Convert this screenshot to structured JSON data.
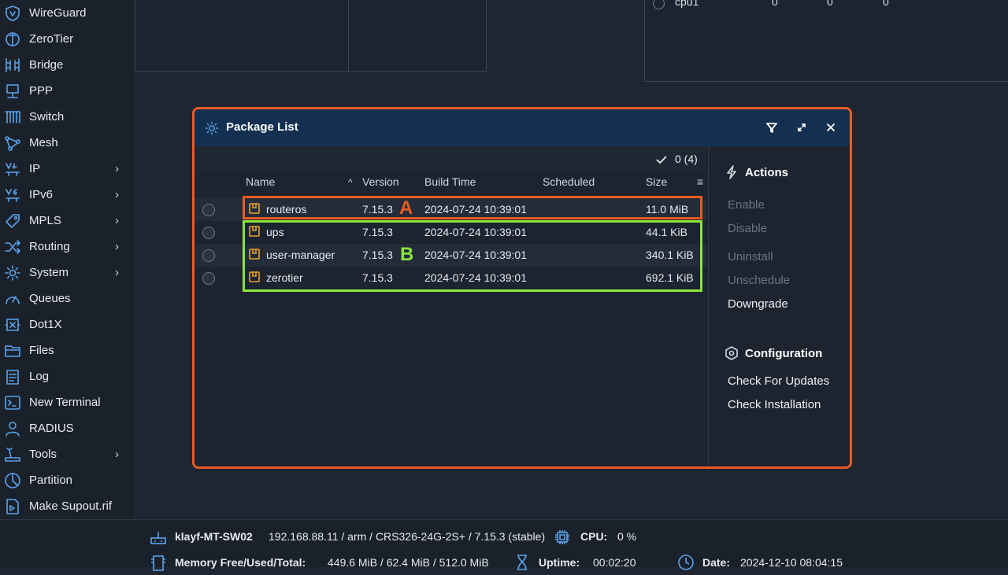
{
  "sidebar": {
    "items": [
      {
        "label": "WireGuard",
        "icon": "wireguard-icon",
        "submenu": false
      },
      {
        "label": "ZeroTier",
        "icon": "zerotier-icon",
        "submenu": false
      },
      {
        "label": "Bridge",
        "icon": "bridge-icon",
        "submenu": false
      },
      {
        "label": "PPP",
        "icon": "ppp-icon",
        "submenu": false
      },
      {
        "label": "Switch",
        "icon": "switch-icon",
        "submenu": false
      },
      {
        "label": "Mesh",
        "icon": "mesh-icon",
        "submenu": false
      },
      {
        "label": "IP",
        "icon": "ipv4-icon",
        "submenu": true
      },
      {
        "label": "IPv6",
        "icon": "ipv6-icon",
        "submenu": true
      },
      {
        "label": "MPLS",
        "icon": "mpls-icon",
        "submenu": true
      },
      {
        "label": "Routing",
        "icon": "routing-icon",
        "submenu": true
      },
      {
        "label": "System",
        "icon": "system-gear-icon",
        "submenu": true
      },
      {
        "label": "Queues",
        "icon": "queues-gauge-icon",
        "submenu": false
      },
      {
        "label": "Dot1X",
        "icon": "dot1x-icon",
        "submenu": false
      },
      {
        "label": "Files",
        "icon": "folder-icon",
        "submenu": false
      },
      {
        "label": "Log",
        "icon": "log-icon",
        "submenu": false
      },
      {
        "label": "New Terminal",
        "icon": "terminal-icon",
        "submenu": false
      },
      {
        "label": "RADIUS",
        "icon": "radius-users-icon",
        "submenu": false
      },
      {
        "label": "Tools",
        "icon": "tools-icon",
        "submenu": true
      },
      {
        "label": "Partition",
        "icon": "partition-icon",
        "submenu": false
      },
      {
        "label": "Make Supout.rif",
        "icon": "supout-file-icon",
        "submenu": false
      }
    ],
    "chevron": "›"
  },
  "background": {
    "cpu_row": {
      "label": "cpu1",
      "v1": "0",
      "v2": "0",
      "v3": "0"
    }
  },
  "dialog": {
    "title": "Package List",
    "count": "0 (4)",
    "columns": {
      "name": "Name",
      "sort_arrow": "^",
      "version": "Version",
      "build_time": "Build Time",
      "scheduled": "Scheduled",
      "size": "Size",
      "menu": "≡"
    },
    "rows": [
      {
        "name": "routeros",
        "version": "7.15.3",
        "build_time": "2024-07-24 10:39:01",
        "scheduled": "",
        "size": "11.0 MiB"
      },
      {
        "name": "ups",
        "version": "7.15.3",
        "build_time": "2024-07-24 10:39:01",
        "scheduled": "",
        "size": "44.1 KiB"
      },
      {
        "name": "user-manager",
        "version": "7.15.3",
        "build_time": "2024-07-24 10:39:01",
        "scheduled": "",
        "size": "340.1 KiB"
      },
      {
        "name": "zerotier",
        "version": "7.15.3",
        "build_time": "2024-07-24 10:39:01",
        "scheduled": "",
        "size": "692.1 KiB"
      }
    ],
    "annotations": {
      "a": "A",
      "b": "B",
      "color_a": "#e95b25",
      "color_b": "#8be53a"
    },
    "actions": {
      "title": "Actions",
      "enable": "Enable",
      "disable": "Disable",
      "uninstall": "Uninstall",
      "unschedule": "Unschedule",
      "downgrade": "Downgrade"
    },
    "configuration": {
      "title": "Configuration",
      "check_updates": "Check For Updates",
      "check_installation": "Check Installation"
    }
  },
  "status": {
    "hostname": "klayf-MT-SW02",
    "device_info": "192.168.88.11 / arm / CRS326-24G-2S+ / 7.15.3 (stable)",
    "cpu_label": "CPU:",
    "cpu_value": "0 %",
    "memory_label": "Memory Free/Used/Total:",
    "memory_value": "449.6 MiB / 62.4 MiB / 512.0 MiB",
    "uptime_label": "Uptime:",
    "uptime_value": "00:02:20",
    "date_label": "Date:",
    "date_value": "2024-12-10 08:04:15"
  },
  "colors": {
    "accent": "#5aa3ea",
    "highlight": "#e95b25",
    "header": "#143051",
    "package": "#f0a02a"
  }
}
